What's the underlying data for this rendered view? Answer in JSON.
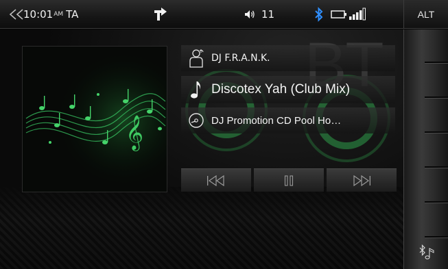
{
  "status_bar": {
    "back_icon": "double-chevron-left-icon",
    "time": "10:01",
    "ampm": "AM",
    "ta_label": "TA",
    "nav_icon": "turn-right-arrow-icon",
    "volume_icon": "speaker-icon",
    "volume_level": "11",
    "bluetooth_icon": "bluetooth-icon",
    "battery_icon": "battery-icon",
    "signal_icon": "signal-bars-icon"
  },
  "alt_button": {
    "label": "ALT"
  },
  "source_watermark": "BT",
  "now_playing": {
    "artist": "DJ F.R.A.N.K.",
    "title": "Discotex Yah (Club Mix)",
    "album": "DJ Promotion CD Pool Ho…"
  },
  "icons": {
    "artist": "person-icon",
    "title": "music-note-icon",
    "album": "disc-icon",
    "prev": "previous-track-icon",
    "pause": "pause-icon",
    "next": "next-track-icon",
    "side_source": "bluetooth-music-icon"
  },
  "colors": {
    "accent_green": "#38c25a",
    "bluetooth_blue": "#2f8fff",
    "text": "#f2f2f2"
  }
}
